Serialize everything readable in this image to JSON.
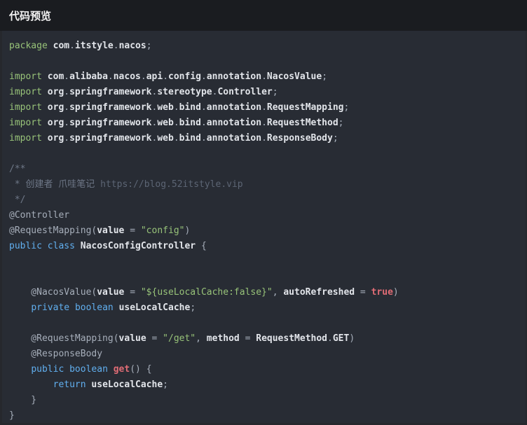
{
  "header": {
    "title": "代码预览"
  },
  "theme": {
    "frame_bg": "#26282d",
    "header_bg": "#1a1c20",
    "code_bg": "#282c34",
    "title_color": "#f2f2f2",
    "plain": "#a6aeba",
    "keyword_green": "#98c379",
    "keyword_blue": "#61afef",
    "string": "#98c379",
    "literal_red": "#e06c75",
    "identifier_bold": "#e2e5ea",
    "comment": "#6e7787",
    "comment_link": "#5c6574"
  },
  "code": {
    "lines": [
      [
        [
          "k",
          "package"
        ],
        [
          "p",
          " "
        ],
        [
          "t",
          "com"
        ],
        [
          "p",
          "."
        ],
        [
          "t",
          "itstyle"
        ],
        [
          "p",
          "."
        ],
        [
          "t",
          "nacos"
        ],
        [
          "p",
          ";"
        ]
      ],
      [],
      [
        [
          "k",
          "import"
        ],
        [
          "p",
          " "
        ],
        [
          "t",
          "com"
        ],
        [
          "p",
          "."
        ],
        [
          "t",
          "alibaba"
        ],
        [
          "p",
          "."
        ],
        [
          "t",
          "nacos"
        ],
        [
          "p",
          "."
        ],
        [
          "t",
          "api"
        ],
        [
          "p",
          "."
        ],
        [
          "t",
          "config"
        ],
        [
          "p",
          "."
        ],
        [
          "t",
          "annotation"
        ],
        [
          "p",
          "."
        ],
        [
          "t",
          "NacosValue"
        ],
        [
          "p",
          ";"
        ]
      ],
      [
        [
          "k",
          "import"
        ],
        [
          "p",
          " "
        ],
        [
          "t",
          "org"
        ],
        [
          "p",
          "."
        ],
        [
          "t",
          "springframework"
        ],
        [
          "p",
          "."
        ],
        [
          "t",
          "stereotype"
        ],
        [
          "p",
          "."
        ],
        [
          "t",
          "Controller"
        ],
        [
          "p",
          ";"
        ]
      ],
      [
        [
          "k",
          "import"
        ],
        [
          "p",
          " "
        ],
        [
          "t",
          "org"
        ],
        [
          "p",
          "."
        ],
        [
          "t",
          "springframework"
        ],
        [
          "p",
          "."
        ],
        [
          "t",
          "web"
        ],
        [
          "p",
          "."
        ],
        [
          "t",
          "bind"
        ],
        [
          "p",
          "."
        ],
        [
          "t",
          "annotation"
        ],
        [
          "p",
          "."
        ],
        [
          "t",
          "RequestMapping"
        ],
        [
          "p",
          ";"
        ]
      ],
      [
        [
          "k",
          "import"
        ],
        [
          "p",
          " "
        ],
        [
          "t",
          "org"
        ],
        [
          "p",
          "."
        ],
        [
          "t",
          "springframework"
        ],
        [
          "p",
          "."
        ],
        [
          "t",
          "web"
        ],
        [
          "p",
          "."
        ],
        [
          "t",
          "bind"
        ],
        [
          "p",
          "."
        ],
        [
          "t",
          "annotation"
        ],
        [
          "p",
          "."
        ],
        [
          "t",
          "RequestMethod"
        ],
        [
          "p",
          ";"
        ]
      ],
      [
        [
          "k",
          "import"
        ],
        [
          "p",
          " "
        ],
        [
          "t",
          "org"
        ],
        [
          "p",
          "."
        ],
        [
          "t",
          "springframework"
        ],
        [
          "p",
          "."
        ],
        [
          "t",
          "web"
        ],
        [
          "p",
          "."
        ],
        [
          "t",
          "bind"
        ],
        [
          "p",
          "."
        ],
        [
          "t",
          "annotation"
        ],
        [
          "p",
          "."
        ],
        [
          "t",
          "ResponseBody"
        ],
        [
          "p",
          ";"
        ]
      ],
      [],
      [
        [
          "m",
          "/**"
        ]
      ],
      [
        [
          "m",
          " * 创建者 爪哇笔记 "
        ],
        [
          "u",
          "https://blog.52itstyle.vip"
        ]
      ],
      [
        [
          "m",
          " */"
        ]
      ],
      [
        [
          "p",
          "@Controller"
        ]
      ],
      [
        [
          "p",
          "@RequestMapping("
        ],
        [
          "t",
          "value"
        ],
        [
          "p",
          " = "
        ],
        [
          "s",
          "\"config\""
        ],
        [
          "p",
          ")"
        ]
      ],
      [
        [
          "c",
          "public"
        ],
        [
          "p",
          " "
        ],
        [
          "c",
          "class"
        ],
        [
          "p",
          " "
        ],
        [
          "t",
          "NacosConfigController"
        ],
        [
          "p",
          " {"
        ]
      ],
      [],
      [],
      [
        [
          "p",
          "    @NacosValue("
        ],
        [
          "t",
          "value"
        ],
        [
          "p",
          " = "
        ],
        [
          "s",
          "\"${useLocalCache:false}\""
        ],
        [
          "p",
          ", "
        ],
        [
          "t",
          "autoRefreshed"
        ],
        [
          "p",
          " = "
        ],
        [
          "r",
          "true"
        ],
        [
          "p",
          ")"
        ]
      ],
      [
        [
          "p",
          "    "
        ],
        [
          "c",
          "private"
        ],
        [
          "p",
          " "
        ],
        [
          "c",
          "boolean"
        ],
        [
          "p",
          " "
        ],
        [
          "t",
          "useLocalCache"
        ],
        [
          "p",
          ";"
        ]
      ],
      [],
      [
        [
          "p",
          "    @RequestMapping("
        ],
        [
          "t",
          "value"
        ],
        [
          "p",
          " = "
        ],
        [
          "s",
          "\"/get\""
        ],
        [
          "p",
          ", "
        ],
        [
          "t",
          "method"
        ],
        [
          "p",
          " = "
        ],
        [
          "t",
          "RequestMethod"
        ],
        [
          "p",
          "."
        ],
        [
          "t",
          "GET"
        ],
        [
          "p",
          ")"
        ]
      ],
      [
        [
          "p",
          "    @ResponseBody"
        ]
      ],
      [
        [
          "p",
          "    "
        ],
        [
          "c",
          "public"
        ],
        [
          "p",
          " "
        ],
        [
          "c",
          "boolean"
        ],
        [
          "p",
          " "
        ],
        [
          "r",
          "get"
        ],
        [
          "p",
          "() {"
        ]
      ],
      [
        [
          "p",
          "        "
        ],
        [
          "c",
          "return"
        ],
        [
          "p",
          " "
        ],
        [
          "t",
          "useLocalCache"
        ],
        [
          "p",
          ";"
        ]
      ],
      [
        [
          "p",
          "    }"
        ]
      ],
      [
        [
          "p",
          "}"
        ]
      ]
    ]
  }
}
